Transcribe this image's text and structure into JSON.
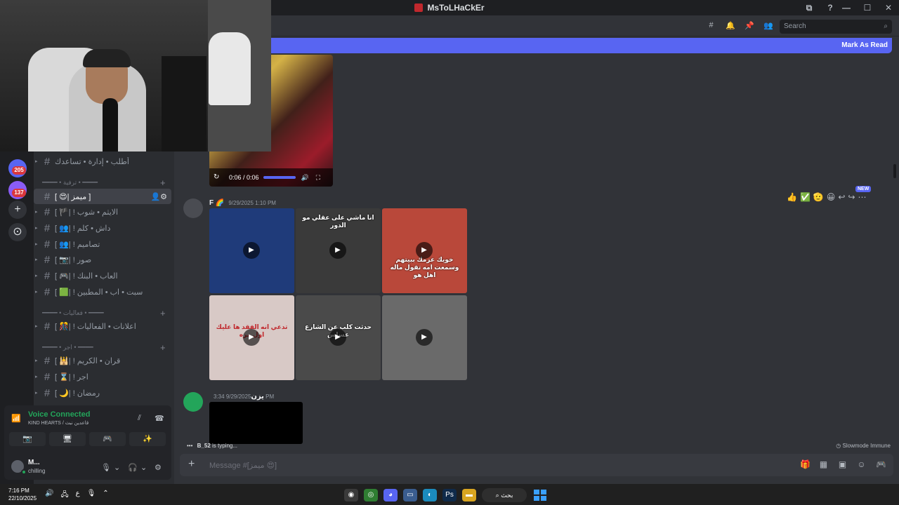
{
  "window": {
    "title": "MsToLHaCkEr",
    "controls": [
      "—",
      "☐",
      "✕"
    ],
    "extras": [
      "⧉",
      "?"
    ]
  },
  "rail": {
    "badges": [
      "205",
      "137"
    ],
    "add_label": "+",
    "explore_label": "⊙"
  },
  "sidebar": {
    "channels_top": [
      {
        "name": "أطلب • إدارة • تساعدك"
      }
    ],
    "category_1": "━━━━ • ترفية • ━━━━",
    "channels_1": [
      {
        "name": "[ 😍| ميمز ]",
        "active": true,
        "tools": "👤⚙"
      },
      {
        "name": "[ 🏴| ! الايثم • شوب",
        "active": false
      },
      {
        "name": "[ 👥| ! داش • كلم",
        "active": false
      },
      {
        "name": "[ 👥| ! تصاميم",
        "active": false
      },
      {
        "name": "[ 📷| ! صور",
        "active": false
      },
      {
        "name": "[ 🎮| ! العاب • البنك",
        "active": false
      },
      {
        "name": "[ 🟩| ! سبت • اب • المطبين",
        "active": false
      }
    ],
    "category_2": "━━━━ • فعاليات • ━━━━",
    "channels_2": [
      {
        "name": "[ 🎊| ! اعلانات • الفعاليات"
      }
    ],
    "category_3": "━━━━ • اجر • ━━━━",
    "channels_3": [
      {
        "name": "[ 🕌| ! قران • الكريم"
      },
      {
        "name": "[ ⌛| ! اجر"
      },
      {
        "name": "[ 🌙| ! رمضان"
      }
    ]
  },
  "voice": {
    "title": "Voice Connected",
    "subtitle": "KIND HEARTS / قاعدين نبث",
    "buttons": [
      "📷",
      "🖥",
      "🎮",
      "✨"
    ]
  },
  "user": {
    "name": "M...",
    "status": "chilling"
  },
  "header": {
    "icons": [
      "threads",
      "bell",
      "pin",
      "members"
    ],
    "search_placeholder": "Search"
  },
  "new_messages": {
    "mark_read": "Mark As Read"
  },
  "video_embed": {
    "time": "0:06 / 0:06"
  },
  "message_1": {
    "author": "F 🌈",
    "timestamp": "9/29/2025 1:10 PM",
    "tiles": [
      {
        "caption": "",
        "color": "#1f3b7a"
      },
      {
        "caption": "انا ماشي على عقلي مو الدور",
        "color": "#3a3a3a"
      },
      {
        "caption": "خويك عزمك ببيتهم وسمعت امه تقول ماله اهل هو",
        "color": "#b9483a"
      },
      {
        "caption": "تدعي انه الفقد ها عليك اول مره",
        "color": "#d8c9c6"
      },
      {
        "caption": "حدثت كلب عن الشارع عساس",
        "color": "#4a4a4a"
      },
      {
        "caption": "",
        "color": "#6a6a6a"
      }
    ]
  },
  "message_actions": [
    "👍",
    "✅",
    "🫡",
    "😀",
    "↩",
    "↪",
    "⋯"
  ],
  "new_tag": "NEW",
  "message_2": {
    "author": "يزن",
    "timestamp": "9/29/2025 3:34 PM"
  },
  "typing": {
    "user": "B_52",
    "text": "is typing..."
  },
  "slowmode": "Slowmode Immune",
  "composer": {
    "placeholder": "Message #[ميمز 😍]"
  },
  "taskbar": {
    "time": "7:16 PM",
    "date": "22/10/2025",
    "search_label": "بحث",
    "lang": "ع"
  }
}
